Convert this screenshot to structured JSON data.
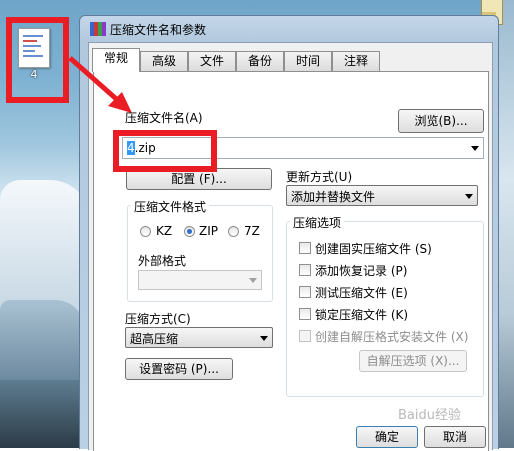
{
  "desktop": {
    "icon_label": "4"
  },
  "dialog": {
    "title": "压缩文件名和参数",
    "tabs": [
      {
        "label": "常规",
        "active": true
      },
      {
        "label": "高级"
      },
      {
        "label": "文件"
      },
      {
        "label": "备份"
      },
      {
        "label": "时间"
      },
      {
        "label": "注释"
      }
    ],
    "archive_name_label": "压缩文件名(A)",
    "browse_button": "浏览(B)...",
    "archive_name_selected": "4",
    "archive_name_rest": ".zip",
    "profiles_button": "配置 (F)...",
    "update_mode_label": "更新方式(U)",
    "update_mode_value": "添加并替换文件",
    "format_group_label": "压缩文件格式",
    "formats": [
      {
        "label": "KZ",
        "selected": false
      },
      {
        "label": "ZIP",
        "selected": true
      },
      {
        "label": "7Z",
        "selected": false
      }
    ],
    "external_format_label": "外部格式",
    "external_format_value": "",
    "options_group_label": "压缩选项",
    "options": [
      {
        "label": "创建固实压缩文件 (S)",
        "checked": false,
        "enabled": true
      },
      {
        "label": "添加恢复记录 (P)",
        "checked": false,
        "enabled": true
      },
      {
        "label": "测试压缩文件 (E)",
        "checked": false,
        "enabled": true
      },
      {
        "label": "锁定压缩文件 (K)",
        "checked": false,
        "enabled": true
      },
      {
        "label": "创建自解压格式安装文件 (X)",
        "checked": false,
        "enabled": false
      }
    ],
    "method_label": "压缩方式(C)",
    "method_value": "超高压缩",
    "sfx_options_button": "自解压选项 (X)...",
    "password_button": "设置密码 (P)...",
    "ok_button": "确定",
    "cancel_button": "取消"
  },
  "watermark": "Baidu经验",
  "colors": {
    "annotation_red": "#ea1d24",
    "selection_blue": "#3399ff"
  }
}
